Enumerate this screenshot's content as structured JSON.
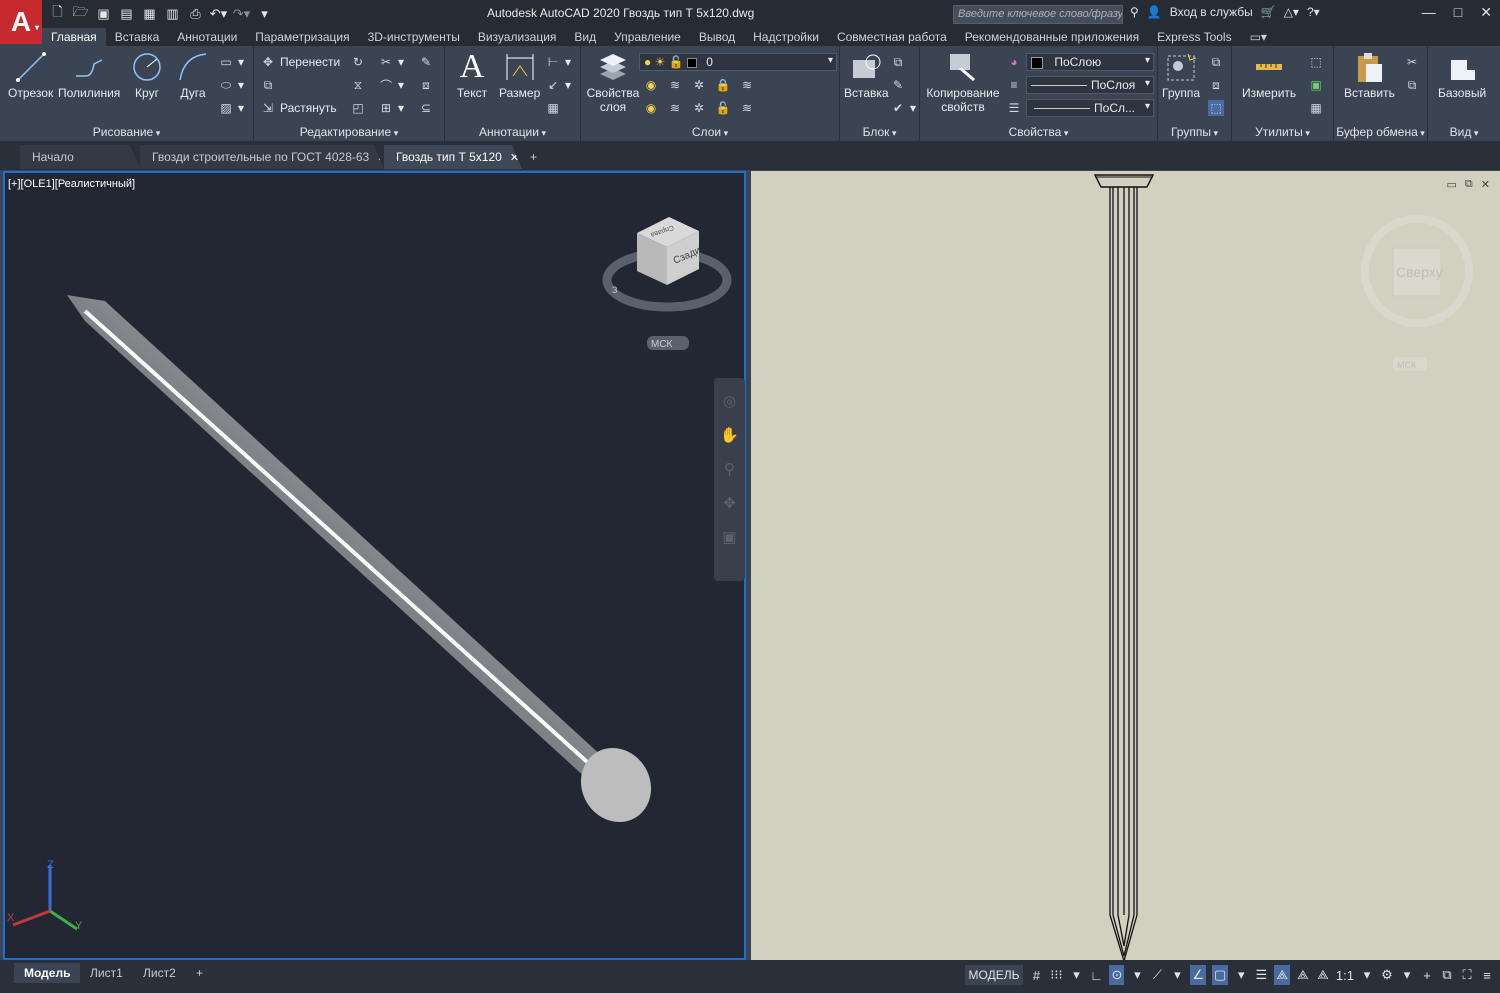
{
  "app": {
    "title": "Autodesk AutoCAD 2020    Гвоздь тип Т 5x120.dwg",
    "logo": "A",
    "search_placeholder": "Введите ключевое слово/фразу",
    "signin": "Вход в службы"
  },
  "ribbon_tabs": [
    "Главная",
    "Вставка",
    "Аннотации",
    "Параметризация",
    "3D-инструменты",
    "Визуализация",
    "Вид",
    "Управление",
    "Вывод",
    "Надстройки",
    "Совместная работа",
    "Рекомендованные приложения",
    "Express Tools"
  ],
  "draw": {
    "line": "Отрезок",
    "polyline": "Полилиния",
    "circle": "Круг",
    "arc": "Дуга",
    "title": "Рисование"
  },
  "modify": {
    "move": "Перенести",
    "stretch": "Растянуть",
    "title": "Редактирование"
  },
  "annotation": {
    "text": "Текст",
    "dimension": "Размер",
    "title": "Аннотации"
  },
  "layers": {
    "props": "Свойства слоя",
    "current": "0",
    "title": "Слои"
  },
  "block": {
    "insert": "Вставка",
    "title": "Блок"
  },
  "properties": {
    "match": "Копирование свойств",
    "color": "ПоСлою",
    "linetype": "ПоСлоя",
    "lineweight": "ПоСл...",
    "title": "Свойства"
  },
  "groups": {
    "group": "Группа",
    "title": "Группы"
  },
  "utilities": {
    "measure": "Измерить",
    "title": "Утилиты"
  },
  "clipboard": {
    "paste": "Вставить",
    "title": "Буфер обмена"
  },
  "view": {
    "base": "Базовый",
    "title": "Вид"
  },
  "doc_tabs": {
    "start": "Начало",
    "tab1": "Гвозди строительные по ГОСТ 4028-63",
    "tab2": "Гвоздь тип Т 5x120"
  },
  "viewport": {
    "left_label": "[+][OLE1][Реалистичный]",
    "cube_face": "Сзади",
    "cube_top": "Справа",
    "wcs": "МСК",
    "right_cube": "Сверху",
    "right_wcs": "МСК"
  },
  "layout_tabs": [
    "Модель",
    "Лист1",
    "Лист2"
  ],
  "status": {
    "model": "МОДЕЛЬ",
    "scale": "1:1"
  }
}
